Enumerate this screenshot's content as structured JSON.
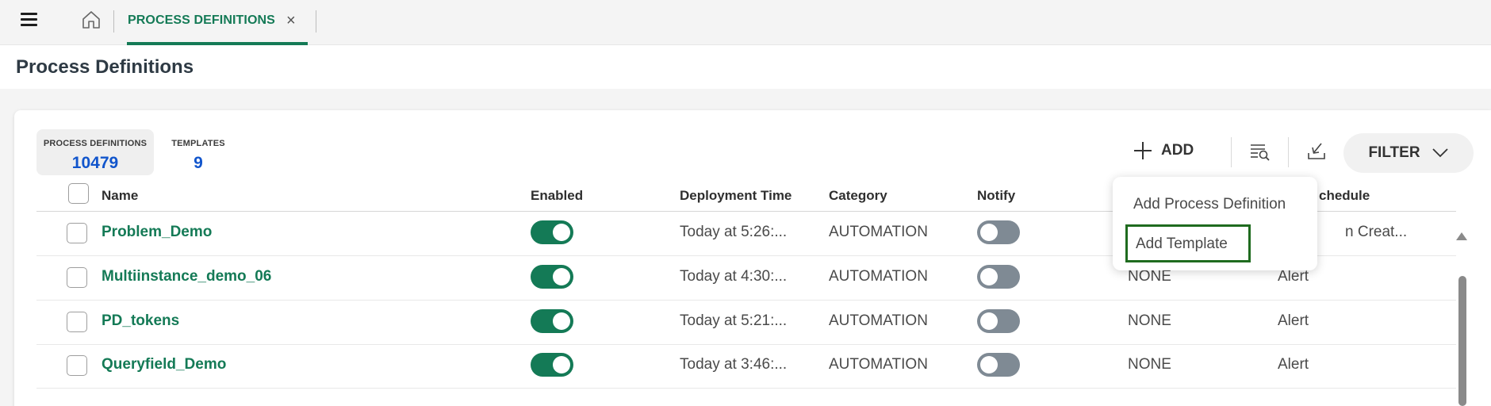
{
  "tabs": {
    "active_label": "PROCESS DEFINITIONS",
    "close_glyph": "×"
  },
  "page": {
    "title": "Process Definitions"
  },
  "stats": {
    "process_definitions": {
      "label": "PROCESS DEFINITIONS",
      "value": "10479"
    },
    "templates": {
      "label": "TEMPLATES",
      "value": "9"
    }
  },
  "toolbar": {
    "add_label": "ADD",
    "filter_label": "FILTER"
  },
  "add_menu": {
    "items": [
      "Add Process Definition",
      "Add Template"
    ]
  },
  "table": {
    "columns": [
      "Name",
      "Enabled",
      "Deployment Time",
      "Category",
      "Notify",
      "Schedule"
    ],
    "schedule_header_visible": "chedule",
    "rows": [
      {
        "name": "Problem_Demo",
        "enabled": true,
        "deployment_time": "Today at 5:26:...",
        "category": "AUTOMATION",
        "notify": false,
        "col6": "",
        "schedule": "n Creat..."
      },
      {
        "name": "Multiinstance_demo_06",
        "enabled": true,
        "deployment_time": "Today at 4:30:...",
        "category": "AUTOMATION",
        "notify": false,
        "col6": "NONE",
        "schedule": "Alert"
      },
      {
        "name": "PD_tokens",
        "enabled": true,
        "deployment_time": "Today at 5:21:...",
        "category": "AUTOMATION",
        "notify": false,
        "col6": "NONE",
        "schedule": "Alert"
      },
      {
        "name": "Queryfield_Demo",
        "enabled": true,
        "deployment_time": "Today at 3:46:...",
        "category": "AUTOMATION",
        "notify": false,
        "col6": "NONE",
        "schedule": "Alert"
      }
    ]
  },
  "icons": {
    "menu": "hamburger-icon",
    "home": "home-icon",
    "close": "close-icon",
    "add": "plus-icon",
    "search_list": "list-search-icon",
    "download": "download-icon",
    "filter_chevron": "chevron-down-icon"
  },
  "colors": {
    "brand_green": "#147a56",
    "link_blue": "#1155cc",
    "toggle_off": "#7f8a94",
    "highlight_border": "#1f6b1f"
  }
}
